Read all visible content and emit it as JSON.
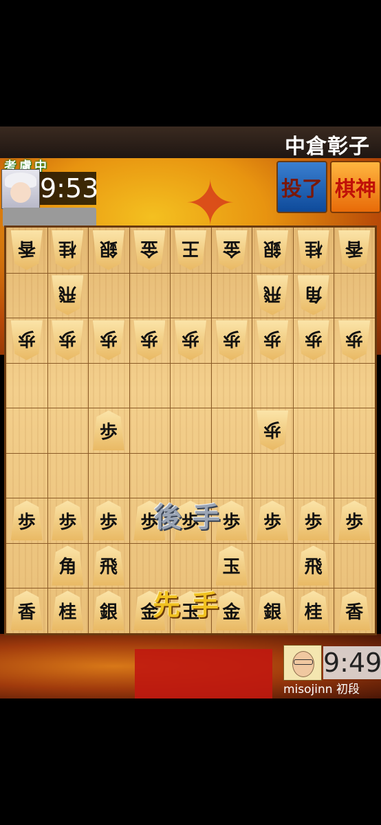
{
  "header": {
    "title": "中倉彰子"
  },
  "opponent": {
    "status": "考慮中",
    "time": "9:53",
    "avatar_icon": "opponent-avatar-icon"
  },
  "buttons": {
    "resign": "投了",
    "kishin": "棋神"
  },
  "labels": {
    "gote": "後手",
    "sente": "先手"
  },
  "player": {
    "time": "9:49",
    "name": "misojinn 初段",
    "avatar_icon": "player-avatar-icon"
  },
  "board": {
    "gote_pieces": [
      {
        "file": 1,
        "rank": 1,
        "char": "香"
      },
      {
        "file": 2,
        "rank": 1,
        "char": "桂"
      },
      {
        "file": 3,
        "rank": 1,
        "char": "銀"
      },
      {
        "file": 4,
        "rank": 1,
        "char": "金"
      },
      {
        "file": 5,
        "rank": 1,
        "char": "王"
      },
      {
        "file": 6,
        "rank": 1,
        "char": "金"
      },
      {
        "file": 7,
        "rank": 1,
        "char": "銀"
      },
      {
        "file": 8,
        "rank": 1,
        "char": "桂"
      },
      {
        "file": 9,
        "rank": 1,
        "char": "香"
      },
      {
        "file": 2,
        "rank": 2,
        "char": "飛"
      },
      {
        "file": 7,
        "rank": 2,
        "char": "飛"
      },
      {
        "file": 8,
        "rank": 2,
        "char": "角"
      },
      {
        "file": 1,
        "rank": 3,
        "char": "歩"
      },
      {
        "file": 2,
        "rank": 3,
        "char": "歩"
      },
      {
        "file": 3,
        "rank": 3,
        "char": "歩"
      },
      {
        "file": 4,
        "rank": 3,
        "char": "歩"
      },
      {
        "file": 5,
        "rank": 3,
        "char": "歩"
      },
      {
        "file": 6,
        "rank": 3,
        "char": "歩"
      },
      {
        "file": 7,
        "rank": 3,
        "char": "歩"
      },
      {
        "file": 8,
        "rank": 3,
        "char": "歩"
      },
      {
        "file": 9,
        "rank": 3,
        "char": "歩"
      },
      {
        "file": 7,
        "rank": 5,
        "char": "歩"
      }
    ],
    "sente_pieces": [
      {
        "file": 3,
        "rank": 5,
        "char": "歩"
      },
      {
        "file": 1,
        "rank": 7,
        "char": "歩"
      },
      {
        "file": 2,
        "rank": 7,
        "char": "歩"
      },
      {
        "file": 3,
        "rank": 7,
        "char": "歩"
      },
      {
        "file": 4,
        "rank": 7,
        "char": "歩"
      },
      {
        "file": 5,
        "rank": 7,
        "char": "歩"
      },
      {
        "file": 6,
        "rank": 7,
        "char": "歩"
      },
      {
        "file": 7,
        "rank": 7,
        "char": "歩"
      },
      {
        "file": 8,
        "rank": 7,
        "char": "歩"
      },
      {
        "file": 9,
        "rank": 7,
        "char": "歩"
      },
      {
        "file": 2,
        "rank": 8,
        "char": "角"
      },
      {
        "file": 3,
        "rank": 8,
        "char": "飛"
      },
      {
        "file": 6,
        "rank": 8,
        "char": "玉"
      },
      {
        "file": 8,
        "rank": 8,
        "char": "飛"
      },
      {
        "file": 1,
        "rank": 9,
        "char": "香"
      },
      {
        "file": 2,
        "rank": 9,
        "char": "桂"
      },
      {
        "file": 3,
        "rank": 9,
        "char": "銀"
      },
      {
        "file": 4,
        "rank": 9,
        "char": "金"
      },
      {
        "file": 5,
        "rank": 9,
        "char": "玉"
      },
      {
        "file": 6,
        "rank": 9,
        "char": "金"
      },
      {
        "file": 7,
        "rank": 9,
        "char": "銀"
      },
      {
        "file": 8,
        "rank": 9,
        "char": "桂"
      },
      {
        "file": 9,
        "rank": 9,
        "char": "香"
      }
    ]
  }
}
